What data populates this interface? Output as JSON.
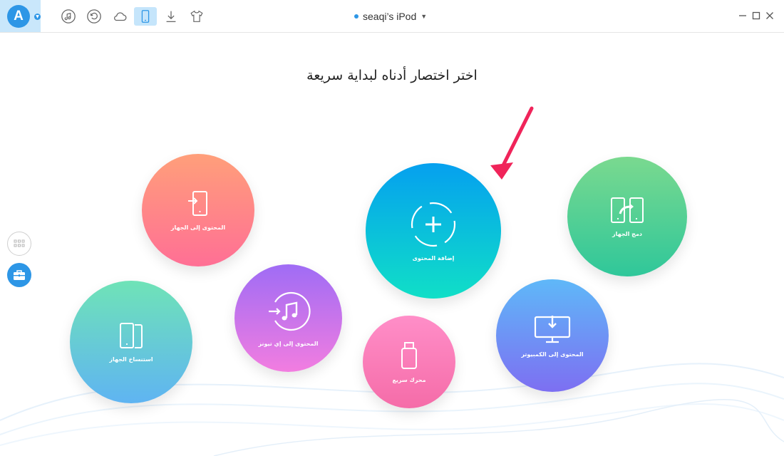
{
  "app": {
    "logo_letter": "A",
    "device_name": "seaqi’s iPod",
    "accent_color": "#2d96e6"
  },
  "toolbar": {
    "icons": [
      "music-note-icon",
      "restore-icon",
      "cloud-icon",
      "phone-icon",
      "download-icon",
      "shirt-icon"
    ],
    "active": "phone-icon"
  },
  "window_controls": [
    "minimize-icon",
    "maximize-icon",
    "close-icon"
  ],
  "headline": "اختر اختصار أدناه لبداية سريعة",
  "shortcuts": {
    "content_to_device": "المحتوى إلى الجهاز",
    "clone_device": "استنساخ الجهاز",
    "content_to_itunes": "المحتوى إلى إي تيونز",
    "add_content": "إضافة المحتوى",
    "flash_drive": "محرك سريع",
    "merge_device": "دمج الجهاز",
    "content_to_computer": "المحتوى إلى الكمبيوتر"
  },
  "colors": {
    "content_to_device": [
      "#ff9f7a",
      "#ff6f95"
    ],
    "clone_device": [
      "#6fe3b7",
      "#5fb4f2"
    ],
    "content_to_itunes": [
      "#9f6cf5",
      "#f27de0"
    ],
    "add_content": [
      "#05a0ef",
      "#10dfc7"
    ],
    "flash_drive": [
      "#ff8ec8",
      "#f56ca8"
    ],
    "merge_device": [
      "#7ad98f",
      "#2fc79a"
    ],
    "content_to_computer": [
      "#5fb8f8",
      "#7d6ff2"
    ],
    "arrow": "#f0245a"
  }
}
